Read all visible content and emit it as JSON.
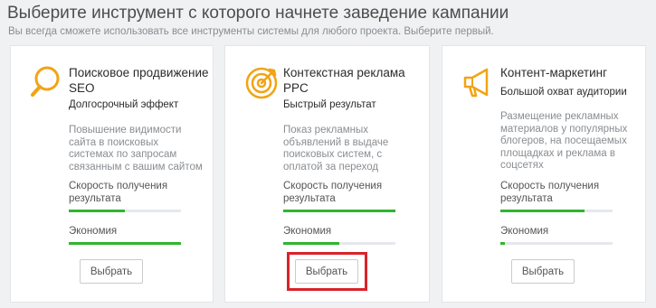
{
  "page": {
    "title": "Выберите инструмент с которого начнете заведение кампании",
    "subtitle": "Вы всегда сможете использовать все инструменты системы для любого проекта. Выберите первый."
  },
  "colors": {
    "accent_icon": "#f2a413",
    "bar_fill": "#2fb52f",
    "highlight": "#d8232a"
  },
  "cards": [
    {
      "icon": "search-icon",
      "title": "Поисковое продвижение SEO",
      "tagline": "Долгосрочный эффект",
      "description": "Повышение видимости сайта в поисковых системах по запросам связанным с вашим сайтом",
      "speed_label": "Скорость получения результата",
      "speed_level": 0.5,
      "economy_label": "Экономия",
      "economy_level": 1.0,
      "button": "Выбрать"
    },
    {
      "icon": "target-icon",
      "title": "Контекстная реклама PPC",
      "tagline": "Быстрый результат",
      "description": "Показ рекламных объявлений в выдаче поисковых систем, с оплатой за переход",
      "speed_label": "Скорость получения результата",
      "speed_level": 1.0,
      "economy_label": "Экономия",
      "economy_level": 0.5,
      "button": "Выбрать"
    },
    {
      "icon": "megaphone-icon",
      "title": "Контент-маркетинг",
      "tagline": "Большой охват аудитории",
      "description": "Размещение рекламных материалов у популярных блогеров, на посещаемых площадках и реклама в соцсетях",
      "speed_label": "Скорость получения результата",
      "speed_level": 0.75,
      "economy_label": "Экономия",
      "economy_level": 0.04,
      "button": "Выбрать"
    }
  ]
}
